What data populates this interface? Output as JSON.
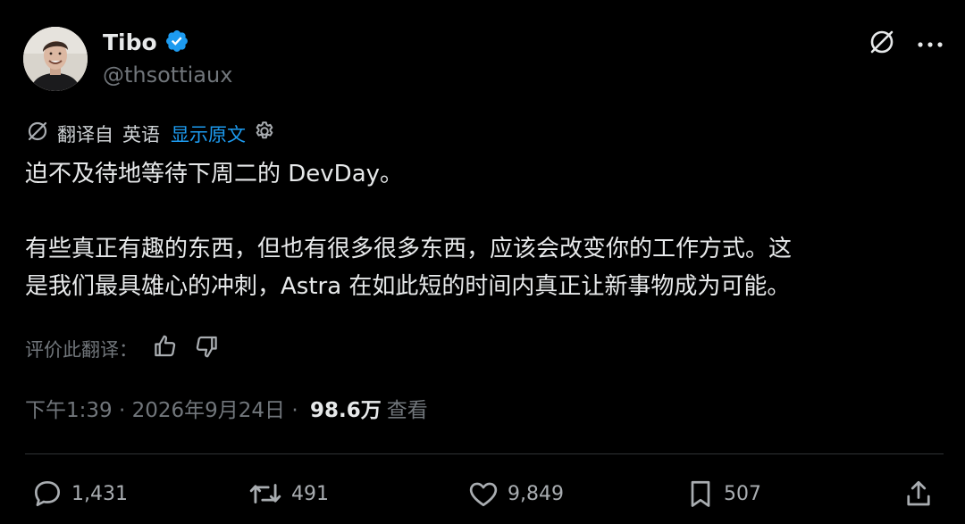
{
  "author": {
    "display_name": "Tibo",
    "handle": "@thsottiaux",
    "verified": true,
    "verified_color": "#1d9bf0"
  },
  "header_icons": {
    "grok_icon": "slashed-circle-icon",
    "more_icon": "more-horizontal-icon"
  },
  "translation": {
    "translated_from_label": "翻译自",
    "source_language": "英语",
    "show_original_label": "显示原文",
    "settings_icon": "gear-icon"
  },
  "tweet": {
    "line1": "迫不及待地等待下周二的 DevDay。",
    "line2": "有些真正有趣的东西，但也有很多很多东西，应该会改变你的工作方式。这",
    "line3": "是我们最具雄心的冲刺，Astra 在如此短的时间内真正让新事物成为可能。"
  },
  "rating": {
    "label": "评价此翻译：",
    "thumbs_up_icon": "thumbs-up-icon",
    "thumbs_down_icon": "thumbs-down-icon"
  },
  "meta": {
    "time": "下午1:39",
    "separator1": " · ",
    "date": "2026年9月24日",
    "separator2": " · ",
    "views_count": "98.6万",
    "views_label": "查看"
  },
  "actions": {
    "replies": "1,431",
    "reposts": "491",
    "likes": "9,849",
    "bookmarks": "507"
  },
  "colors": {
    "background": "#000000",
    "text_primary": "#e7e9ea",
    "text_secondary": "#71767b",
    "link": "#1d9bf0"
  }
}
